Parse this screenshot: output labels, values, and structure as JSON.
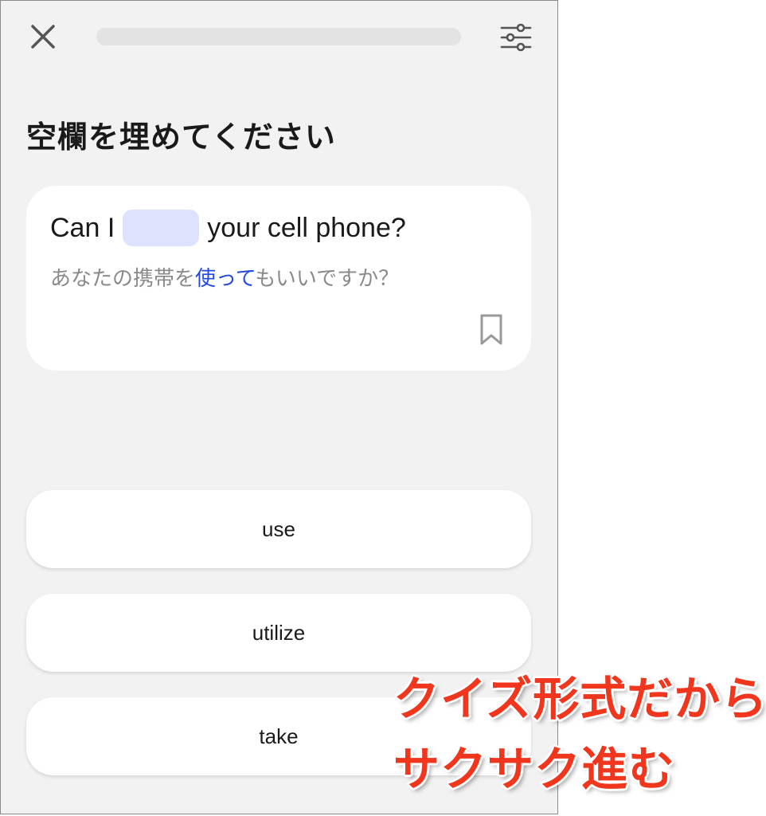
{
  "header": {
    "close_icon": "close-icon",
    "settings_icon": "sliders-icon",
    "progress": 0
  },
  "question": {
    "title": "空欄を埋めてください",
    "sentence_before": "Can I",
    "sentence_after": "your cell phone?",
    "translation_before": "あなたの携帯を",
    "translation_highlight": "使って",
    "translation_after": "もいいですか？",
    "bookmark_icon": "bookmark-icon"
  },
  "options": [
    {
      "label": "use"
    },
    {
      "label": "utilize"
    },
    {
      "label": "take"
    }
  ],
  "overlay": {
    "line1": "クイズ形式だから",
    "line2": "サクサク進む"
  },
  "colors": {
    "background": "#f2f2f2",
    "blank": "#dde3fc",
    "highlight": "#2549e0",
    "caption": "#f0361d"
  }
}
